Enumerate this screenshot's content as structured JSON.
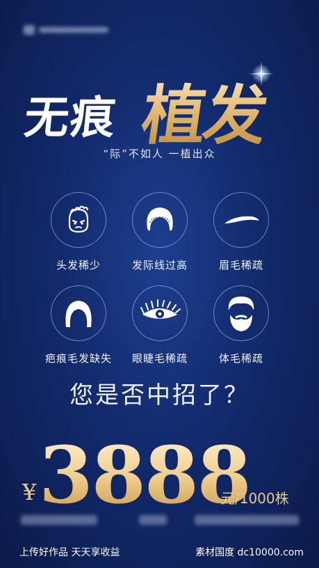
{
  "title": {
    "white_part": "无痕",
    "gold_part": "植发",
    "subtitle": "“际”不如人 一植出众"
  },
  "items": [
    {
      "label": "头发稀少",
      "icon": "sparse-hair-head-icon"
    },
    {
      "label": "发际线过高",
      "icon": "high-hairline-icon"
    },
    {
      "label": "眉毛稀疏",
      "icon": "sparse-eyebrow-icon"
    },
    {
      "label": "疤痕毛发缺失",
      "icon": "scar-hair-loss-icon"
    },
    {
      "label": "眼睫毛稀疏",
      "icon": "eyelash-icon"
    },
    {
      "label": "体毛稀疏",
      "icon": "beard-icon"
    }
  ],
  "question": "您是否中招了？",
  "price": {
    "currency": "¥",
    "amount": "3888",
    "unit": "元/1000株"
  },
  "footer": {
    "left": "上传好作品  天天享收益",
    "right": "素材国度  dc10000.com"
  },
  "colors": {
    "background": "#122a6c",
    "gold": "#e9c98c"
  }
}
